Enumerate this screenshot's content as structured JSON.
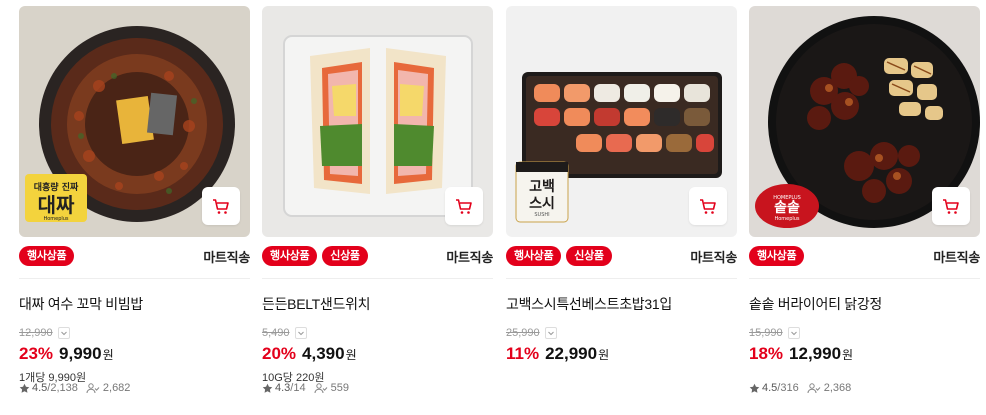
{
  "products": [
    {
      "name": "대짜 여수 꼬막 비빔밥",
      "badges": [
        "행사상품"
      ],
      "mart": "마트직송",
      "original_price": "12,990",
      "discount_rate": "23%",
      "price": "9,990",
      "currency": "원",
      "unit_price": "1개당 9,990원",
      "rating": "4.5",
      "review_count": "/2,138",
      "buyer_count": "2,682",
      "image_text": [
        "대흥량 진짜",
        "대짜",
        "Homeplus"
      ]
    },
    {
      "name": "든든BELT샌드위치",
      "badges": [
        "행사상품",
        "신상품"
      ],
      "mart": "마트직송",
      "original_price": "5,490",
      "discount_rate": "20%",
      "price": "4,390",
      "currency": "원",
      "unit_price": "10G당 220원",
      "rating": "4.3",
      "review_count": "/14",
      "buyer_count": "559"
    },
    {
      "name": "고백스시특선베스트초밥31입",
      "badges": [
        "행사상품",
        "신상품"
      ],
      "mart": "마트직송",
      "original_price": "25,990",
      "discount_rate": "11%",
      "price": "22,990",
      "currency": "원",
      "image_text": [
        "고백스시",
        "SUSHI",
        "Homeplus"
      ]
    },
    {
      "name": "솥솥 버라이어티 닭강정",
      "badges": [
        "행사상품"
      ],
      "mart": "마트직송",
      "original_price": "15,990",
      "discount_rate": "18%",
      "price": "12,990",
      "currency": "원",
      "rating": "4.5",
      "review_count": "/316",
      "buyer_count": "2,368",
      "image_text": [
        "솥솥",
        "Homeplus"
      ]
    }
  ],
  "colors": {
    "accent": "#e3001b",
    "muted": "#999999"
  },
  "icons": {
    "cart": "cart-icon",
    "star": "star-icon",
    "buyers": "buyers-icon",
    "dropdown": "chevron-down-icon"
  }
}
